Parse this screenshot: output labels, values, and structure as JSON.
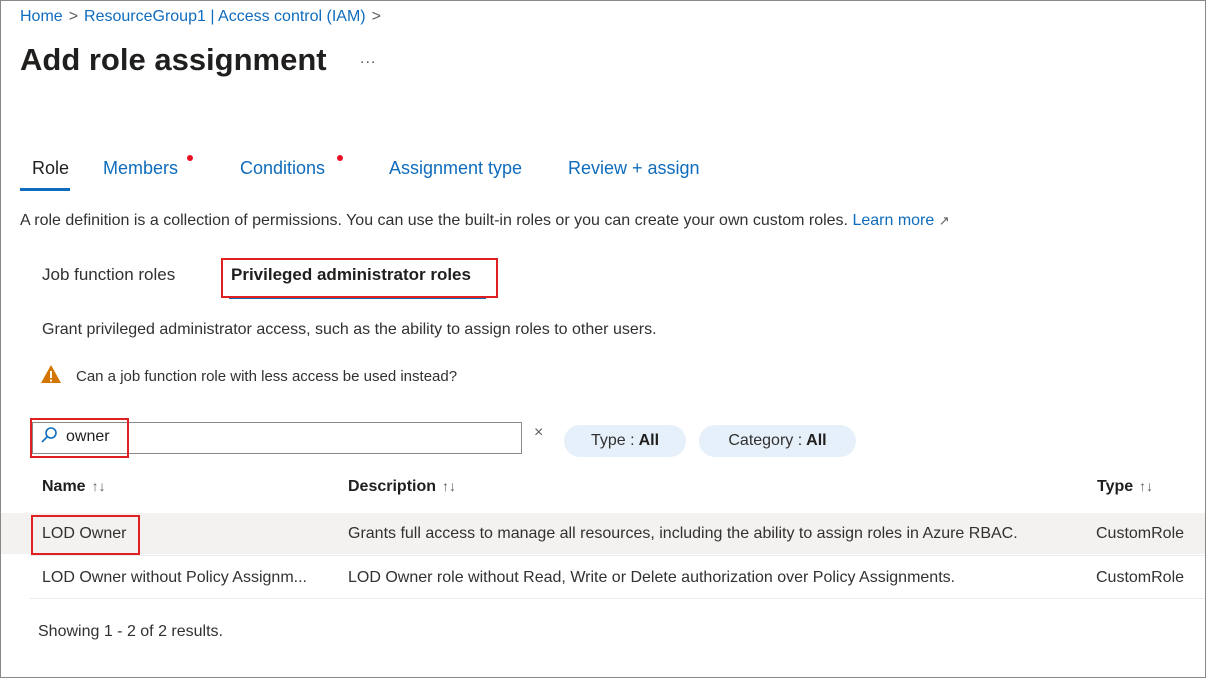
{
  "breadcrumb": {
    "home": "Home",
    "sep1": ">",
    "resource": "ResourceGroup1 | Access control (IAM)",
    "sep2": ">"
  },
  "page": {
    "title": "Add role assignment",
    "more": "..."
  },
  "tabs": [
    {
      "label": "Role",
      "active": true,
      "required": false
    },
    {
      "label": "Members",
      "active": false,
      "required": true
    },
    {
      "label": "Conditions",
      "active": false,
      "required": true
    },
    {
      "label": "Assignment type",
      "active": false,
      "required": false
    },
    {
      "label": "Review + assign",
      "active": false,
      "required": false
    }
  ],
  "description": {
    "text": "A role definition is a collection of permissions. You can use the built-in roles or you can create your own custom roles.",
    "learn_more": "Learn more"
  },
  "subtabs": [
    {
      "label": "Job function roles",
      "active": false
    },
    {
      "label": "Privileged administrator roles",
      "active": true
    }
  ],
  "privileged": {
    "grant_text": "Grant privileged administrator access, such as the ability to assign roles to other users.",
    "warning_text": "Can a job function role with less access be used instead?"
  },
  "filters": {
    "search_value": "owner",
    "clear": "×",
    "type_label": "Type :",
    "type_value": "All",
    "category_label": "Category :",
    "category_value": "All"
  },
  "table": {
    "columns": [
      "Name",
      "Description",
      "Type"
    ],
    "sort_indicator": "↑↓",
    "rows": [
      {
        "name": "LOD Owner",
        "description": "Grants full access to manage all resources, including the ability to assign roles in Azure RBAC.",
        "type": "CustomRole",
        "selected": true
      },
      {
        "name": "LOD Owner without Policy Assignm...",
        "description": "LOD Owner role without Read, Write or Delete authorization over Policy Assignments.",
        "type": "CustomRole",
        "selected": false
      }
    ]
  },
  "footer": {
    "results": "Showing 1 - 2 of 2 results."
  },
  "colors": {
    "accent": "#0f6cbd",
    "highlight_box": "#e02020",
    "required_dot": "#e81123",
    "warning": "#d47500",
    "pill_bg": "#e6f0fa"
  }
}
